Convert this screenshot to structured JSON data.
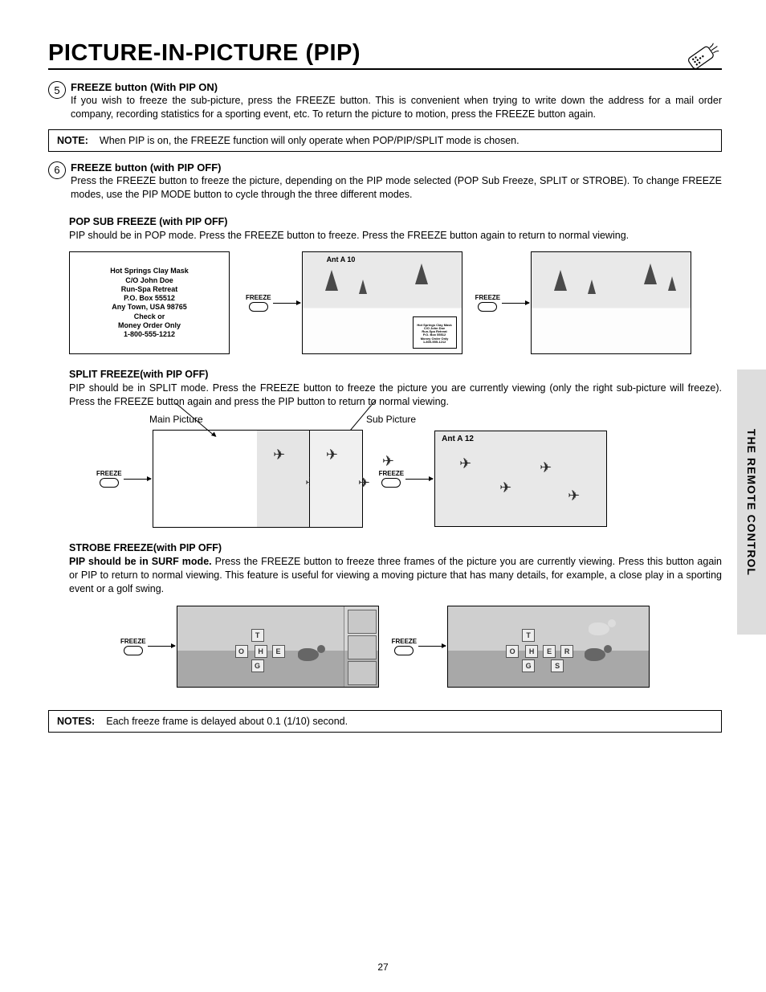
{
  "title": "PICTURE-IN-PICTURE (PIP)",
  "tab_label": "THE REMOTE CONTROL",
  "page_number": "27",
  "step5": {
    "num": "5",
    "title": "FREEZE button (With PIP ON)",
    "body": "If you wish to freeze the sub-picture, press the FREEZE button. This is convenient when trying to write down the address for a mail order company, recording statistics for a sporting event, etc.  To return the picture to motion, press the FREEZE button again."
  },
  "note1_label": "NOTE:",
  "note1_body": "When PIP is on, the FREEZE function will only operate when POP/PIP/SPLIT mode is chosen.",
  "step6": {
    "num": "6",
    "title": "FREEZE button (with PIP OFF)",
    "body": "Press the FREEZE button to freeze the picture, depending on the PIP mode selected (POP Sub Freeze, SPLIT or STROBE). To change FREEZE modes, use the PIP MODE button to cycle through the three different modes."
  },
  "pop": {
    "title": "POP SUB FREEZE (with PIP OFF)",
    "body": "PIP should be in POP mode.  Press the FREEZE button to freeze.  Press the FREEZE button again to return to normal viewing.",
    "ad_lines": [
      "Hot Springs Clay Mask",
      "C/O John Doe",
      "Run-Spa Retreat",
      "P.O. Box 55512",
      "Any Town, USA 98765",
      "Check or",
      "Money Order Only",
      "1-800-555-1212"
    ],
    "osd": "Ant A   10"
  },
  "freeze_label": "FREEZE",
  "split": {
    "title": "SPLIT FREEZE(with PIP OFF)",
    "body": "PIP should be in SPLIT mode.  Press the FREEZE button to freeze the picture you are currently viewing (only the right sub-picture will freeze).  Press the FREEZE button again and press the PIP button to return to normal viewing.",
    "main_label": "Main Picture",
    "sub_label": "Sub Picture",
    "osd": "Ant A 12"
  },
  "strobe": {
    "title": "STROBE FREEZE(with PIP OFF)",
    "lead": "PIP should be in SURF mode.",
    "body_rest": "  Press the FREEZE button to freeze three frames of the picture you are currently viewing. Press this button again or PIP to return to normal viewing. This feature is useful for viewing a moving picture that has many details, for example, a close play in a sporting event or a golf swing.",
    "tiles1": [
      "O",
      "T",
      "H",
      "E"
    ],
    "tiles1b": [
      "G"
    ],
    "tiles2": [
      "O",
      "T",
      "H",
      "E",
      "R"
    ],
    "tiles2b": [
      "G",
      "",
      "S"
    ]
  },
  "note2_label": "NOTES:",
  "note2_body": "Each freeze frame is delayed about 0.1 (1/10) second."
}
